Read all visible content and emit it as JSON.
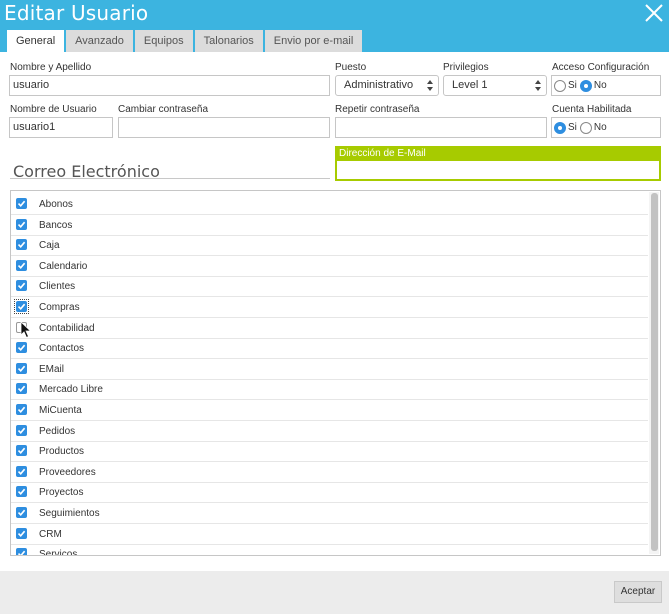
{
  "window": {
    "title": "Editar Usuario"
  },
  "tabs": [
    {
      "label": "General",
      "active": true
    },
    {
      "label": "Avanzado",
      "active": false
    },
    {
      "label": "Equipos",
      "active": false
    },
    {
      "label": "Talonarios",
      "active": false
    },
    {
      "label": "Envio por e-mail",
      "active": false
    }
  ],
  "form": {
    "nombre_apellido": {
      "label": "Nombre y Apellido",
      "value": "usuario"
    },
    "puesto": {
      "label": "Puesto",
      "value": "Administrativo"
    },
    "privilegios": {
      "label": "Privilegios",
      "value": "Level 1"
    },
    "acceso_config": {
      "label": "Acceso Configuración",
      "options": [
        "Si",
        "No"
      ],
      "selected": "No"
    },
    "nombre_usuario": {
      "label": "Nombre de Usuario",
      "value": "usuario1"
    },
    "cambiar_pass": {
      "label": "Cambiar contraseña",
      "value": ""
    },
    "repetir_pass": {
      "label": "Repetir contraseña",
      "value": ""
    },
    "cuenta_habilitada": {
      "label": "Cuenta Habilitada",
      "options": [
        "Si",
        "No"
      ],
      "selected": "Si"
    }
  },
  "email_section": {
    "title": "Correo Electrónico",
    "field_label": "Dirección de E-Mail",
    "value": ""
  },
  "modules": [
    {
      "label": "Abonos",
      "checked": true
    },
    {
      "label": "Bancos",
      "checked": true
    },
    {
      "label": "Caja",
      "checked": true
    },
    {
      "label": "Calendario",
      "checked": true
    },
    {
      "label": "Clientes",
      "checked": true
    },
    {
      "label": "Compras",
      "checked": true,
      "focused": true
    },
    {
      "label": "Contabilidad",
      "checked": false
    },
    {
      "label": "Contactos",
      "checked": true
    },
    {
      "label": "EMail",
      "checked": true
    },
    {
      "label": "Mercado Libre",
      "checked": true
    },
    {
      "label": "MiCuenta",
      "checked": true
    },
    {
      "label": "Pedidos",
      "checked": true
    },
    {
      "label": "Productos",
      "checked": true
    },
    {
      "label": "Proveedores",
      "checked": true
    },
    {
      "label": "Proyectos",
      "checked": true
    },
    {
      "label": "Seguimientos",
      "checked": true
    },
    {
      "label": "CRM",
      "checked": true
    },
    {
      "label": "Servicos",
      "checked": true
    }
  ],
  "footer": {
    "accept_label": "Aceptar"
  },
  "colors": {
    "titlebar": "#3cb4e0",
    "email_accent": "#a7cb00",
    "checkbox": "#2e8ee0"
  }
}
